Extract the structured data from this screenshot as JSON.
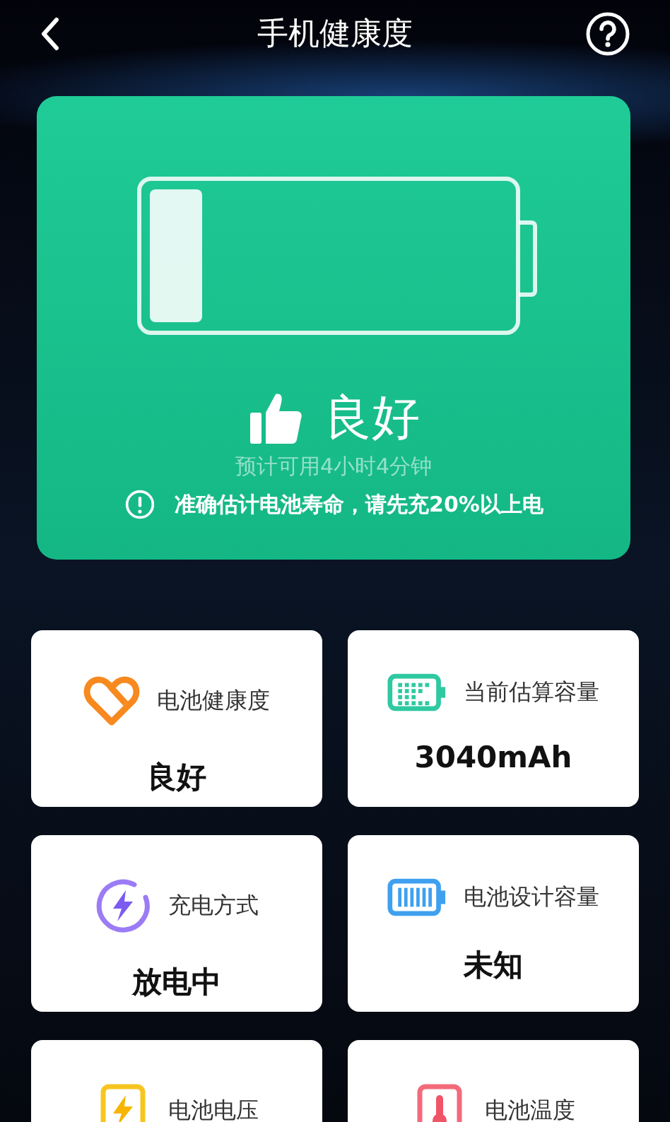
{
  "header": {
    "title": "手机健康度"
  },
  "summary": {
    "battery": {
      "level": 0.15
    },
    "status": "良好",
    "estimate": "预计可用4小时4分钟",
    "notice": "准确估计电池寿命，请先充20%以上电"
  },
  "cards": [
    {
      "kind": "heart",
      "label": "电池健康度",
      "value": "良好"
    },
    {
      "kind": "capacity",
      "label": "当前估算容量",
      "value": "3040mAh"
    },
    {
      "kind": "charge",
      "label": "充电方式",
      "value": "放电中"
    },
    {
      "kind": "design",
      "label": "电池设计容量",
      "value": "未知"
    },
    {
      "kind": "voltage",
      "label": "电池电压"
    },
    {
      "kind": "temperature",
      "label": "电池温度"
    }
  ]
}
